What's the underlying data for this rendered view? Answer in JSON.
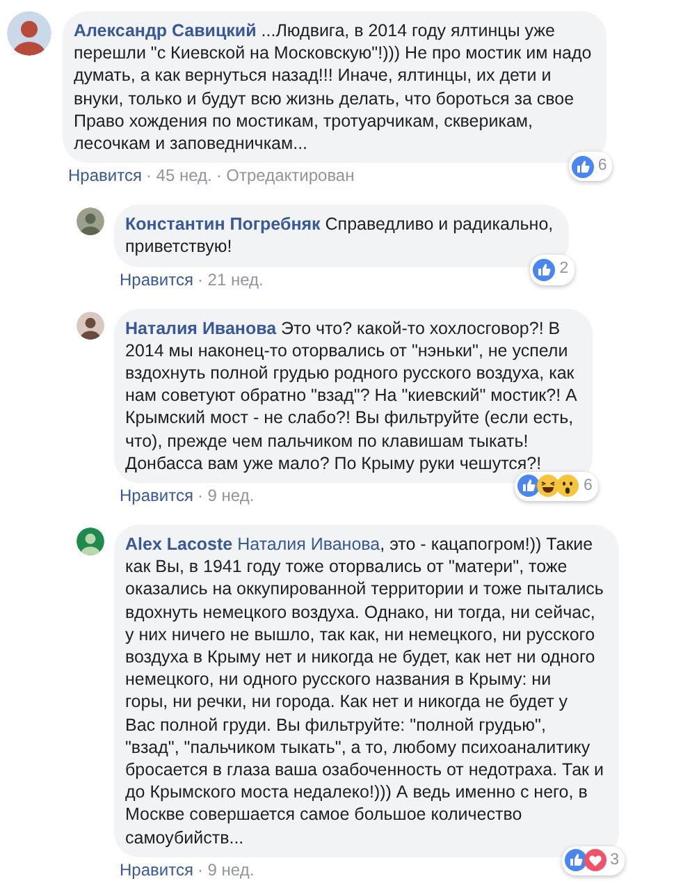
{
  "comments": [
    {
      "author": "Александр Савицкий",
      "reply": false,
      "lines": [
        "...Людвига, в 2014 году ялтинцы уже",
        "перешли \"с Киевской на Московскую\"!))) Не про мостик им надо",
        "думать, а как вернуться назад!!! Иначе, ялтинцы, их дети и",
        "внуки, только и будут всю жизнь делать, что бороться за свое",
        "Право хождения по мостикам, тротуарчикам, скверикам,",
        "лесочкам и заповедничкам..."
      ],
      "reactions": [
        {
          "kind": "like"
        }
      ],
      "reaction_count": "6",
      "like_link": "Нравится",
      "meta": [
        "· 45 нед.",
        "· Отредактирован"
      ]
    },
    {
      "author": "Константин Погребняк",
      "reply": true,
      "lines": [
        "Справедливо и радикально,",
        "приветствую!"
      ],
      "reactions": [
        {
          "kind": "like"
        }
      ],
      "reaction_count": "2",
      "like_link": "Нравится",
      "meta": [
        "· 21 нед."
      ]
    },
    {
      "author": "Наталия Иванова",
      "reply": true,
      "lines": [
        "Это что? какой-то хохлосговор?! В",
        "2014 мы наконец-то оторвались от \"нэньки\", не успели",
        "вздохнуть полной грудью родного русского воздуха, как",
        "нам советуют обратно \"взад\"? На \"киевский\" мостик?! А",
        "Крымский мост - не слабо?! Вы фильтруйте (если есть,",
        "что), прежде чем пальчиком по клавишам тыкать!",
        "Донбасса вам уже мало? По Крыму руки чешутся?!"
      ],
      "reactions": [
        {
          "kind": "like"
        },
        {
          "kind": "haha"
        },
        {
          "kind": "wow"
        }
      ],
      "reaction_count": "6",
      "like_link": "Нравится",
      "meta": [
        "· 9 нед."
      ]
    },
    {
      "author": "Alex Lacoste",
      "reply": true,
      "mention": "Наталия Иванова",
      "lines": [
        ", это - кацапогром!)) Такие",
        "как Вы, в 1941 году тоже оторвались от \"матери\", тоже",
        "оказались на оккупированной территории и тоже пытались",
        "вдохнуть немецкого воздуха. Однако, ни тогда, ни сейчас,",
        "у них ничего не вышло, так как, ни немецкого, ни русского",
        "воздуха в Крыму нет и никогда не будет, как нет ни одного",
        "немецкого, ни одного русского названия в Крыму: ни",
        "горы, ни речки, ни города. Как нет и никогда не будет у",
        "Вас полной груди. Вы фильтруйте: \"полной грудью\",",
        "\"взад\", \"пальчиком тыкать\", а то, любому психоаналитику",
        "бросается в глаза ваша озабоченность от недотраха. Так и",
        "до Крымского моста недалеко!))) А ведь именно с него, в",
        "Москве совершается самое большое количество",
        "самоубийств..."
      ],
      "reactions": [
        {
          "kind": "like"
        },
        {
          "kind": "love"
        }
      ],
      "reaction_count": "3",
      "like_link": "Нравится",
      "meta": [
        "· 9 нед."
      ]
    }
  ]
}
